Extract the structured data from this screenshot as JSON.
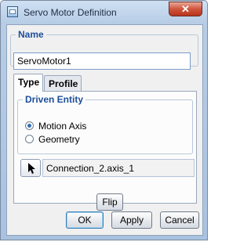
{
  "window": {
    "title": "Servo Motor Definition",
    "close_glyph": "✕"
  },
  "name": {
    "legend": "Name",
    "value": "ServoMotor1"
  },
  "tabs": [
    {
      "label": "Type"
    },
    {
      "label": "Profile"
    }
  ],
  "driven_entity": {
    "legend": "Driven Entity",
    "options": [
      {
        "label": "Motion Axis",
        "selected": true
      },
      {
        "label": "Geometry",
        "selected": false
      }
    ],
    "reference_value": "Connection_2.axis_1",
    "flip_label": "Flip"
  },
  "footer": {
    "ok_label": "OK",
    "apply_label": "Apply",
    "cancel_label": "Cancel"
  },
  "colors": {
    "legend": "#1e4e9a",
    "title_bar": "#b7cde6",
    "close": "#d0553c"
  }
}
